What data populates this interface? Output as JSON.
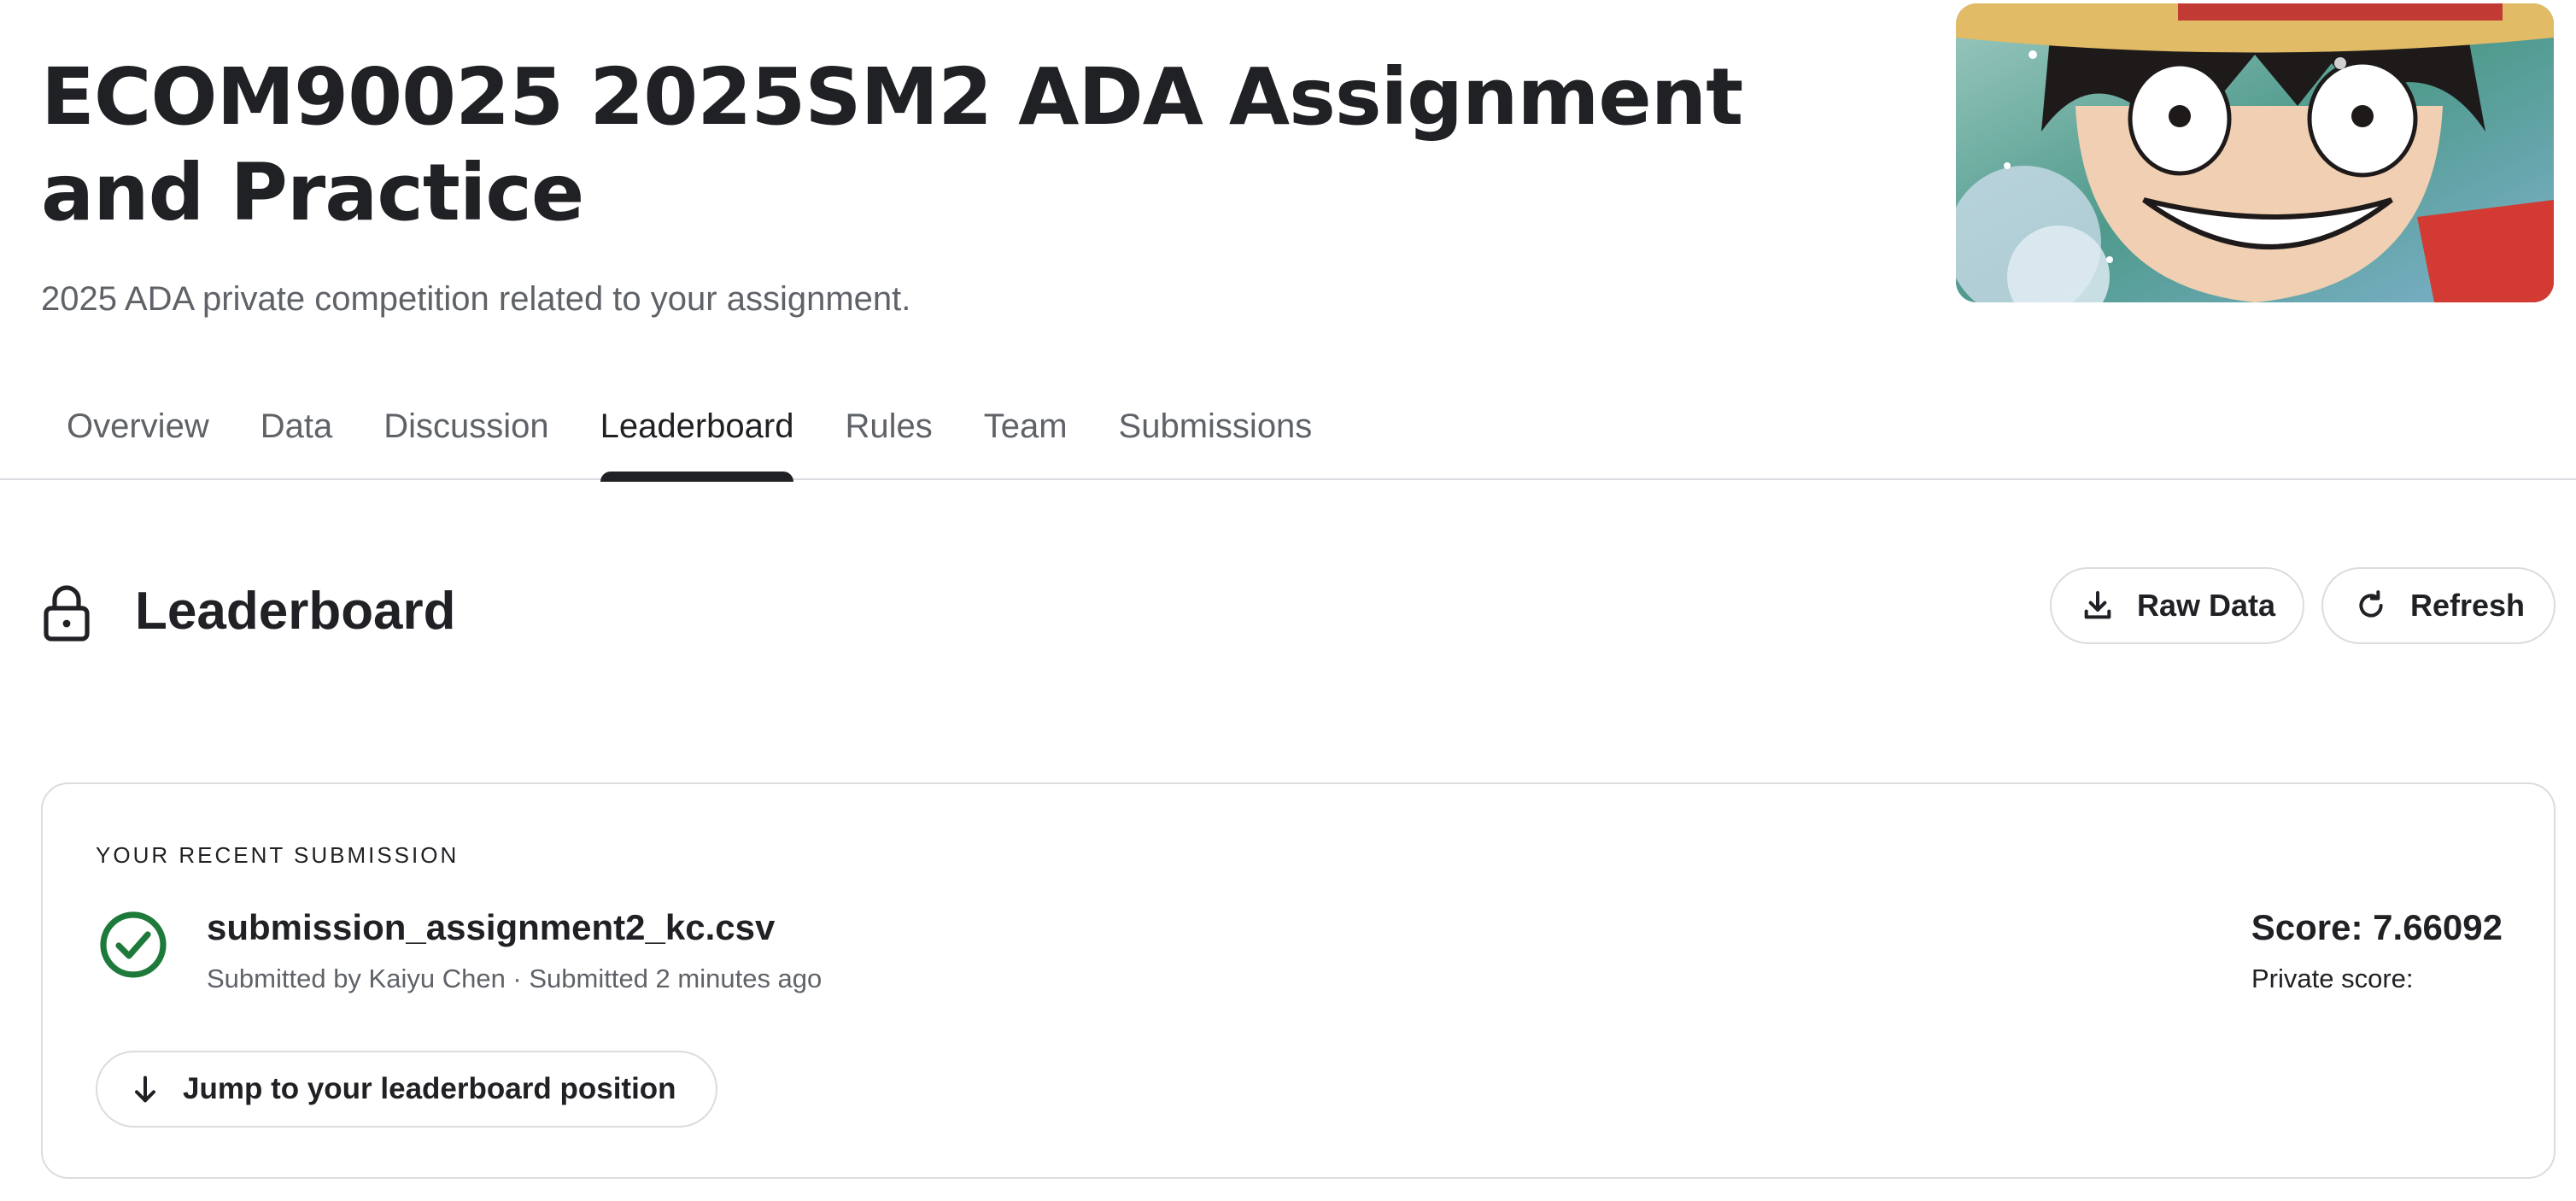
{
  "header": {
    "title": "ECOM90025 2025SM2 ADA Assignment and Practice",
    "subtitle": "2025 ADA private competition related to your assignment."
  },
  "tabs": [
    {
      "label": "Overview",
      "active": false
    },
    {
      "label": "Data",
      "active": false
    },
    {
      "label": "Discussion",
      "active": false
    },
    {
      "label": "Leaderboard",
      "active": true
    },
    {
      "label": "Rules",
      "active": false
    },
    {
      "label": "Team",
      "active": false
    },
    {
      "label": "Submissions",
      "active": false
    }
  ],
  "section": {
    "title": "Leaderboard",
    "raw_data_label": "Raw Data",
    "refresh_label": "Refresh"
  },
  "recent_submission": {
    "heading": "YOUR RECENT SUBMISSION",
    "file_name": "submission_assignment2_kc.csv",
    "meta": "Submitted by Kaiyu Chen · Submitted 2 minutes ago",
    "score": "Score: 7.66092",
    "private_score": "Private score:",
    "jump_label": "Jump to your leaderboard position"
  },
  "colors": {
    "text": "#202124",
    "muted": "#5f6368",
    "border": "#dadce0",
    "success": "#1e7a3a"
  },
  "icons": [
    "lock-icon",
    "download-icon",
    "refresh-icon",
    "check-circle-icon",
    "arrow-down-icon"
  ]
}
